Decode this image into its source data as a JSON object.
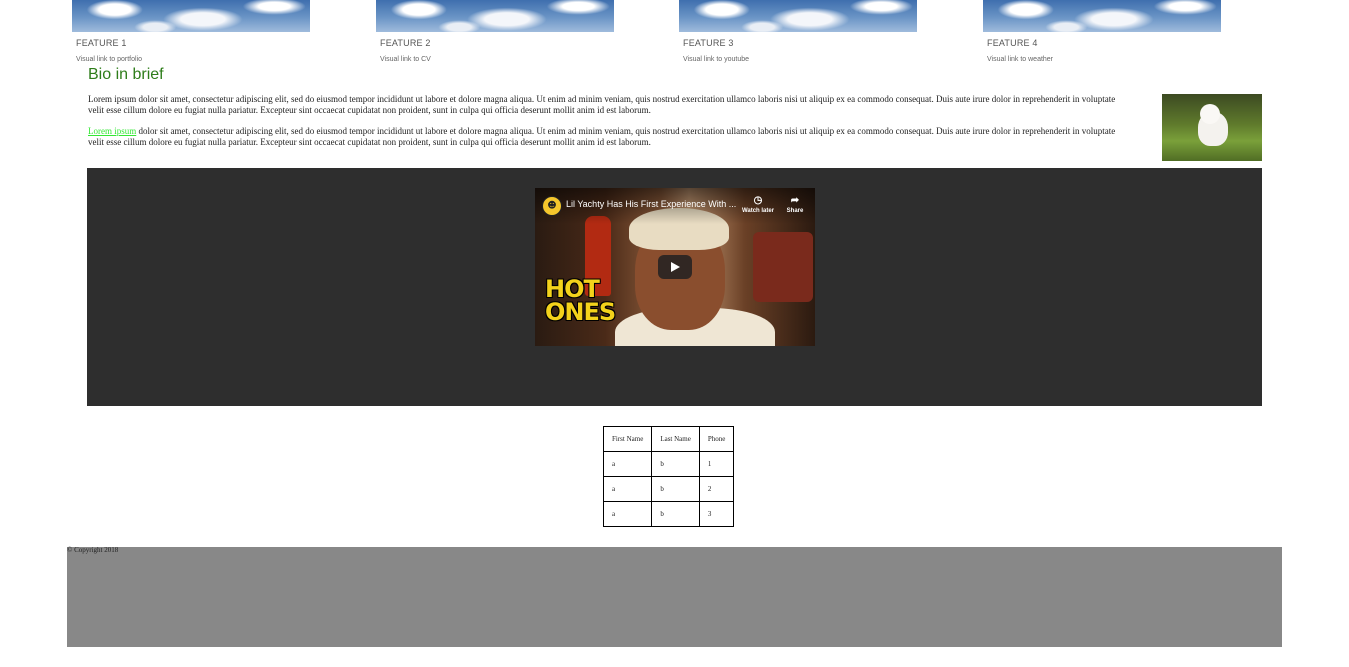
{
  "features": [
    {
      "title": "FEATURE 1",
      "link": "Visual link to portfolio"
    },
    {
      "title": "FEATURE 2",
      "link": "Visual link to CV"
    },
    {
      "title": "FEATURE 3",
      "link": "Visual link to youtube"
    },
    {
      "title": "FEATURE 4",
      "link": "Visual link to weather"
    }
  ],
  "bio": {
    "heading": "Bio in brief",
    "paragraph1": "Lorem ipsum dolor sit amet, consectetur adipiscing elit, sed do eiusmod tempor incididunt ut labore et dolore magna aliqua. Ut enim ad minim veniam, quis nostrud exercitation ullamco laboris nisi ut aliquip ex ea commodo consequat. Duis aute irure dolor in reprehenderit in voluptate velit esse cillum dolore eu fugiat nulla pariatur. Excepteur sint occaecat cupidatat non proident, sunt in culpa qui officia deserunt mollit anim id est laborum.",
    "paragraph2_link": "Lorem ipsum",
    "paragraph2_rest": " dolor sit amet, consectetur adipiscing elit, sed do eiusmod tempor incididunt ut labore et dolore magna aliqua. Ut enim ad minim veniam, quis nostrud exercitation ullamco laboris nisi ut aliquip ex ea commodo consequat. Duis aute irure dolor in reprehenderit in voluptate velit esse cillum dolore eu fugiat nulla pariatur. Excepteur sint occaecat cupidatat non proident, sunt in culpa qui officia deserunt mollit anim id est laborum."
  },
  "video": {
    "title": "Lil Yachty Has His First Experience With ...",
    "watch_later": "Watch later",
    "share": "Share",
    "logo_text": "HOT ONES",
    "channel_icon": "☻"
  },
  "table": {
    "headers": [
      "First Name",
      "Last Name",
      "Phone"
    ],
    "rows": [
      [
        "a",
        "b",
        "1"
      ],
      [
        "a",
        "b",
        "2"
      ],
      [
        "a",
        "b",
        "3"
      ]
    ]
  },
  "footer": {
    "copyright": "© Copyright 2018"
  },
  "colors": {
    "heading": "#2e7d1a",
    "link": "#33e733",
    "video_bg": "#2e2e2e",
    "footer_bg": "#888888"
  }
}
